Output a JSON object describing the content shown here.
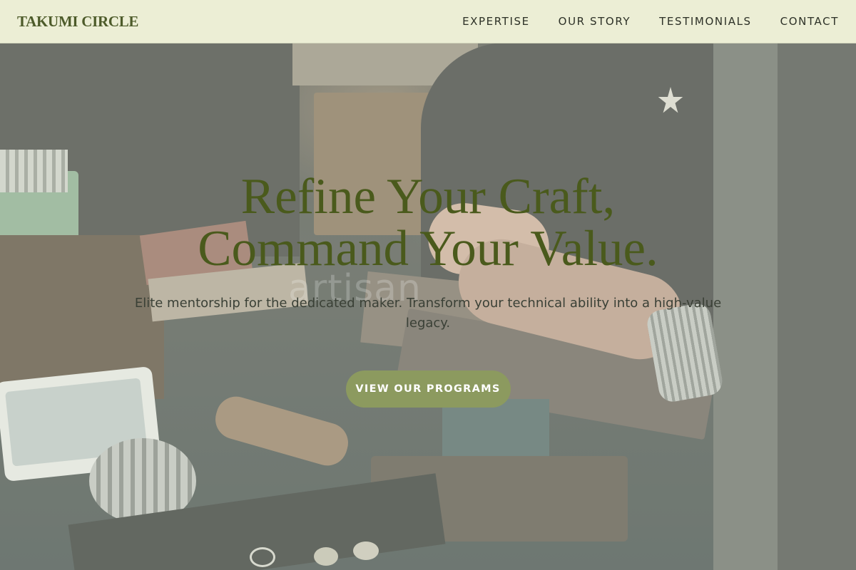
{
  "brand": "TAKUMI CIRCLE",
  "nav": {
    "items": [
      "EXPERTISE",
      "OUR STORY",
      "TESTIMONIALS",
      "CONTACT"
    ]
  },
  "hero": {
    "title_line1": "Refine Your Craft,",
    "title_line2": "Command Your Value.",
    "subtitle": "Elite mentorship for the dedicated maker. Transform your technical ability into a high-value legacy.",
    "cta_label": "VIEW OUR PROGRAMS",
    "watermark": "artisan",
    "background_description_icon": "jeweler-workbench-photo"
  },
  "colors": {
    "nav_bg": "#eceed5",
    "brand": "#4d5b2a",
    "title": "#4a5a1c",
    "cta_bg": "#8c9a5f",
    "cta_text": "#ffffff"
  }
}
